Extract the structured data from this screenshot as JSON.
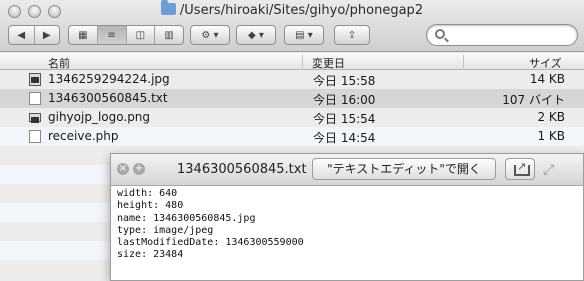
{
  "window": {
    "title": "/Users/hiroaki/Sites/gihyo/phonegap2"
  },
  "toolbar": {
    "nav_back_icon": "chevron-left-icon",
    "nav_forward_icon": "chevron-right-icon",
    "views": [
      "icon-view-icon",
      "list-view-icon",
      "column-view-icon",
      "coverflow-view-icon"
    ],
    "active_view": "list-view-icon",
    "action_icon": "gear-icon",
    "dropbox_icon": "dropbox-icon",
    "arrange_icon": "arrange-icon",
    "share_icon": "share-icon",
    "search": {
      "placeholder": "",
      "value": ""
    }
  },
  "columns": {
    "name": "名前",
    "date": "変更日",
    "size": "サイズ"
  },
  "files": [
    {
      "name": "1346259294224.jpg",
      "date": "今日 15:58",
      "size": "14 KB",
      "kind": "image",
      "selected": false
    },
    {
      "name": "1346300560845.txt",
      "date": "今日 16:00",
      "size": "107 バイト",
      "kind": "text",
      "selected": true
    },
    {
      "name": "gihyojp_logo.png",
      "date": "今日 15:54",
      "size": "2 KB",
      "kind": "image",
      "selected": false
    },
    {
      "name": "receive.php",
      "date": "今日 14:54",
      "size": "1 KB",
      "kind": "text",
      "selected": false
    }
  ],
  "quicklook": {
    "title": "1346300560845.txt",
    "open_button": "\"テキストエディット\"で開く",
    "lines": [
      "width: 640",
      "height: 480",
      "name: 1346300560845.jpg",
      "type: image/jpeg",
      "lastModifiedDate: 1346300559000",
      "size: 23484"
    ]
  }
}
